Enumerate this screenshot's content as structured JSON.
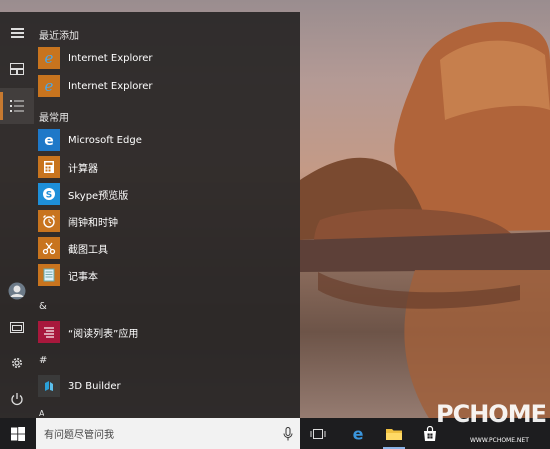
{
  "start_menu": {
    "groups": {
      "recent": "最近添加",
      "frequent": "最常用",
      "amp": "&",
      "hash": "#",
      "a_partial": "A"
    },
    "recent_apps": [
      {
        "label": "Internet Explorer",
        "icon": "internet-explorer-icon"
      },
      {
        "label": "Internet Explorer",
        "icon": "internet-explorer-icon"
      }
    ],
    "frequent_apps": [
      {
        "label": "Microsoft Edge",
        "icon": "edge-icon"
      },
      {
        "label": "计算器",
        "icon": "calculator-icon"
      },
      {
        "label": "Skype预览版",
        "icon": "skype-icon"
      },
      {
        "label": "闹钟和时钟",
        "icon": "alarm-clock-icon"
      },
      {
        "label": "截图工具",
        "icon": "snipping-tool-icon"
      },
      {
        "label": "记事本",
        "icon": "notepad-icon"
      }
    ],
    "amp_apps": [
      {
        "label": "“阅读列表”应用",
        "icon": "reading-list-icon"
      }
    ],
    "hash_apps": [
      {
        "label": "3D Builder",
        "icon": "3d-builder-icon"
      }
    ]
  },
  "taskbar": {
    "search_placeholder": "有问题尽管问我",
    "icons": [
      "windows-logo-icon",
      "microphone-icon",
      "task-view-icon",
      "edge-icon",
      "file-explorer-icon",
      "store-icon"
    ]
  },
  "watermark": {
    "main": "PCHOME",
    "sub": "WWW.PCHOME.NET"
  },
  "colors": {
    "accent": "#c87a30",
    "edge_blue": "#1e78c8",
    "tile_orange": "#c8741e",
    "reading_list": "#a8183c"
  }
}
